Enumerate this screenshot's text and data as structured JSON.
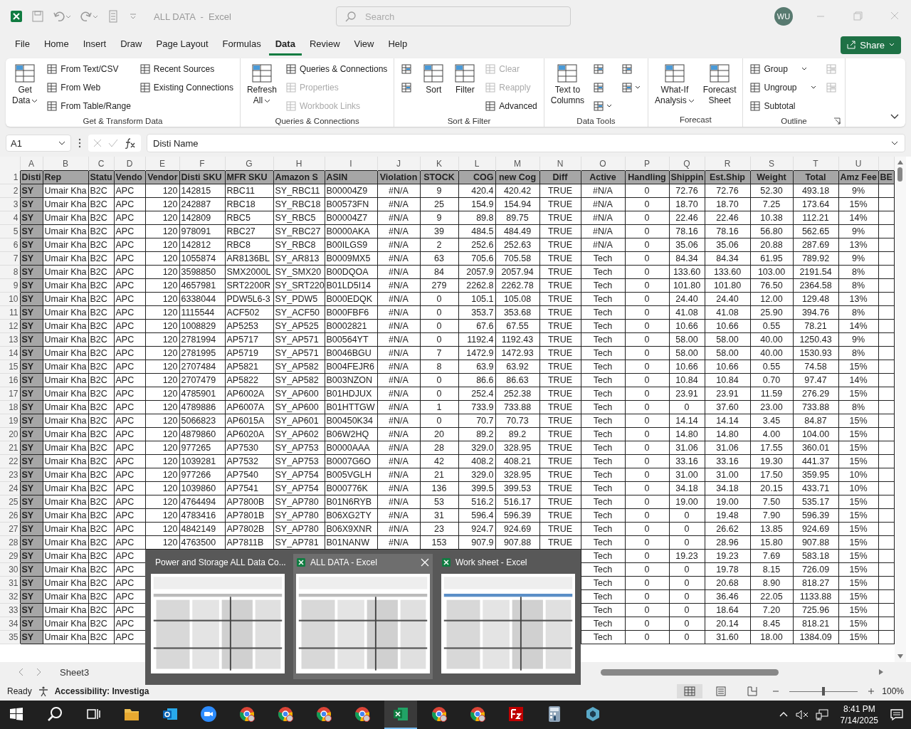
{
  "title_bar": {
    "title": "ALL DATA  -  Excel",
    "search_placeholder": "Search",
    "avatar": "WU"
  },
  "menu_tabs": [
    {
      "label": "File",
      "selected": false
    },
    {
      "label": "Home",
      "selected": false
    },
    {
      "label": "Insert",
      "selected": false
    },
    {
      "label": "Draw",
      "selected": false
    },
    {
      "label": "Page Layout",
      "selected": false
    },
    {
      "label": "Formulas",
      "selected": false
    },
    {
      "label": "Data",
      "selected": true
    },
    {
      "label": "Review",
      "selected": false
    },
    {
      "label": "View",
      "selected": false
    },
    {
      "label": "Help",
      "selected": false
    }
  ],
  "share_button": "Share",
  "ribbon_groups": [
    {
      "label": "Get & Transform Data",
      "columns": [
        [
          {
            "kind": "large",
            "lines": [
              "Get",
              "Data"
            ],
            "dropdown": true,
            "disabled": false
          }
        ],
        [
          {
            "kind": "small",
            "label": "From Text/CSV",
            "disabled": false
          },
          {
            "kind": "small",
            "label": "From Web",
            "disabled": false
          },
          {
            "kind": "small",
            "label": "From Table/Range",
            "disabled": false
          }
        ],
        [
          {
            "kind": "small",
            "label": "Recent Sources",
            "disabled": false
          },
          {
            "kind": "small",
            "label": "Existing Connections",
            "disabled": false
          }
        ]
      ]
    },
    {
      "label": "Queries & Connections",
      "columns": [
        [
          {
            "kind": "large",
            "lines": [
              "Refresh",
              "All"
            ],
            "dropdown": true,
            "disabled": false
          }
        ],
        [
          {
            "kind": "small",
            "label": "Queries & Connections",
            "disabled": false
          },
          {
            "kind": "small",
            "label": "Properties",
            "disabled": true
          },
          {
            "kind": "small",
            "label": "Workbook Links",
            "disabled": true
          }
        ]
      ]
    },
    {
      "label": "Sort & Filter",
      "columns": [
        [
          {
            "kind": "icon",
            "disabled": false
          },
          {
            "kind": "icon",
            "disabled": false
          }
        ],
        [
          {
            "kind": "large",
            "lines": [
              "Sort"
            ],
            "disabled": false
          }
        ],
        [
          {
            "kind": "large",
            "lines": [
              "Filter"
            ],
            "disabled": false
          }
        ],
        [
          {
            "kind": "small",
            "label": "Clear",
            "disabled": true
          },
          {
            "kind": "small",
            "label": "Reapply",
            "disabled": true
          },
          {
            "kind": "small",
            "label": "Advanced",
            "disabled": false
          }
        ]
      ]
    },
    {
      "label": "Data Tools",
      "columns": [
        [
          {
            "kind": "large",
            "lines": [
              "Text to",
              "Columns"
            ],
            "disabled": false
          }
        ],
        [
          {
            "kind": "icon",
            "disabled": false
          },
          {
            "kind": "icon",
            "disabled": false
          },
          {
            "kind": "icon",
            "dropdown": true,
            "disabled": false
          }
        ],
        [
          {
            "kind": "icon",
            "disabled": false
          },
          {
            "kind": "icon",
            "dropdown": true,
            "disabled": false
          }
        ]
      ]
    },
    {
      "label": "Forecast",
      "columns": [
        [
          {
            "kind": "large",
            "lines": [
              "What-If",
              "Analysis"
            ],
            "dropdown": true,
            "disabled": false
          }
        ],
        [
          {
            "kind": "large",
            "lines": [
              "Forecast",
              "Sheet"
            ],
            "disabled": false
          }
        ]
      ]
    },
    {
      "label": "Outline",
      "launcher": true,
      "columns": [
        [
          {
            "kind": "small",
            "label": "Group",
            "dropdown": true,
            "disabled": false
          },
          {
            "kind": "small",
            "label": "Ungroup",
            "dropdown": true,
            "disabled": false
          },
          {
            "kind": "small",
            "label": "Subtotal",
            "disabled": false
          }
        ],
        [
          {
            "kind": "icon",
            "disabled": true
          },
          {
            "kind": "icon",
            "disabled": true
          }
        ]
      ]
    }
  ],
  "formula_bar": {
    "name_box": "A1",
    "value": "Disti Name"
  },
  "sheet": {
    "columns": [
      "A",
      "B",
      "C",
      "D",
      "E",
      "F",
      "G",
      "H",
      "I",
      "J",
      "K",
      "L",
      "M",
      "N",
      "O",
      "P",
      "Q",
      "R",
      "S",
      "T",
      "U"
    ],
    "rows": [
      {
        "number": "1",
        "cells": [
          "Disti",
          "Rep",
          "Statu",
          "Vendo",
          "Vendor",
          "Disti SKU",
          "MFR SKU",
          "Amazon S",
          "ASIN",
          "Violation",
          "STOCK",
          "COG",
          "new Cog",
          "Diff",
          "Active",
          "Handling",
          "Shippin",
          "Est.Ship",
          "Weight",
          "Total",
          "Amz Fee",
          "BE"
        ]
      },
      {
        "number": "2",
        "cells": [
          "SY",
          "Umair Kha",
          "B2C",
          "APC",
          "120",
          "142815",
          "RBC11",
          "SY_RBC11",
          "B00004Z9",
          "#N/A",
          "9",
          "420.4",
          "420.42",
          "TRUE",
          "#N/A",
          "0",
          "72.76",
          "72.76",
          "52.30",
          "493.18",
          "9%"
        ]
      },
      {
        "number": "3",
        "cells": [
          "SY",
          "Umair Kha",
          "B2C",
          "APC",
          "120",
          "242887",
          "RBC18",
          "SY_RBC18",
          "B00573FN",
          "#N/A",
          "25",
          "154.9",
          "154.94",
          "TRUE",
          "#N/A",
          "0",
          "18.70",
          "18.70",
          "7.25",
          "173.64",
          "15%"
        ]
      },
      {
        "number": "4",
        "cells": [
          "SY",
          "Umair Kha",
          "B2C",
          "APC",
          "120",
          "142809",
          "RBC5",
          "SY_RBC5",
          "B00004Z7",
          "#N/A",
          "9",
          "89.8",
          "89.75",
          "TRUE",
          "#N/A",
          "0",
          "22.46",
          "22.46",
          "10.38",
          "112.21",
          "14%"
        ]
      },
      {
        "number": "5",
        "cells": [
          "SY",
          "Umair Kha",
          "B2C",
          "APC",
          "120",
          "978091",
          "RBC27",
          "SY_RBC27",
          "B0000AKA",
          "#N/A",
          "39",
          "484.5",
          "484.49",
          "TRUE",
          "#N/A",
          "0",
          "78.16",
          "78.16",
          "56.80",
          "562.65",
          "9%"
        ]
      },
      {
        "number": "6",
        "cells": [
          "SY",
          "Umair Kha",
          "B2C",
          "APC",
          "120",
          "142812",
          "RBC8",
          "SY_RBC8",
          "B00ILGS9",
          "#N/A",
          "2",
          "252.6",
          "252.63",
          "TRUE",
          "#N/A",
          "0",
          "35.06",
          "35.06",
          "20.88",
          "287.69",
          "13%"
        ]
      },
      {
        "number": "7",
        "cells": [
          "SY",
          "Umair Kha",
          "B2C",
          "APC",
          "120",
          "1055874",
          "AR8136BL",
          "SY_AR813",
          "B0009MX5",
          "#N/A",
          "63",
          "705.6",
          "705.58",
          "TRUE",
          "Tech",
          "0",
          "84.34",
          "84.34",
          "61.95",
          "789.92",
          "9%"
        ]
      },
      {
        "number": "8",
        "cells": [
          "SY",
          "Umair Kha",
          "B2C",
          "APC",
          "120",
          "3598850",
          "SMX2000L",
          "SY_SMX20",
          "B00DQOA",
          "#N/A",
          "84",
          "2057.9",
          "2057.94",
          "TRUE",
          "Tech",
          "0",
          "133.60",
          "133.60",
          "103.00",
          "2191.54",
          "8%"
        ]
      },
      {
        "number": "9",
        "cells": [
          "SY",
          "Umair Kha",
          "B2C",
          "APC",
          "120",
          "4657981",
          "SRT2200R",
          "SY_SRT220",
          "B01LD5I14",
          "#N/A",
          "279",
          "2262.8",
          "2262.78",
          "TRUE",
          "Tech",
          "0",
          "101.80",
          "101.80",
          "76.50",
          "2364.58",
          "8%"
        ]
      },
      {
        "number": "10",
        "cells": [
          "SY",
          "Umair Kha",
          "B2C",
          "APC",
          "120",
          "6338044",
          "PDW5L6-3",
          "SY_PDW5",
          "B000EDQK",
          "#N/A",
          "0",
          "105.1",
          "105.08",
          "TRUE",
          "Tech",
          "0",
          "24.40",
          "24.40",
          "12.00",
          "129.48",
          "13%"
        ]
      },
      {
        "number": "11",
        "cells": [
          "SY",
          "Umair Kha",
          "B2C",
          "APC",
          "120",
          "1115544",
          "ACF502",
          "SY_ACF50",
          "B000FBF6",
          "#N/A",
          "0",
          "353.7",
          "353.68",
          "TRUE",
          "Tech",
          "0",
          "41.08",
          "41.08",
          "25.90",
          "394.76",
          "8%"
        ]
      },
      {
        "number": "12",
        "cells": [
          "SY",
          "Umair Kha",
          "B2C",
          "APC",
          "120",
          "1008829",
          "AP5253",
          "SY_AP525",
          "B0002821",
          "#N/A",
          "0",
          "67.6",
          "67.55",
          "TRUE",
          "Tech",
          "0",
          "10.66",
          "10.66",
          "0.55",
          "78.21",
          "14%"
        ]
      },
      {
        "number": "13",
        "cells": [
          "SY",
          "Umair Kha",
          "B2C",
          "APC",
          "120",
          "2781994",
          "AP5717",
          "SY_AP571",
          "B00564YT",
          "#N/A",
          "0",
          "1192.4",
          "1192.43",
          "TRUE",
          "Tech",
          "0",
          "58.00",
          "58.00",
          "40.00",
          "1250.43",
          "9%"
        ]
      },
      {
        "number": "14",
        "cells": [
          "SY",
          "Umair Kha",
          "B2C",
          "APC",
          "120",
          "2781995",
          "AP5719",
          "SY_AP571",
          "B0046BGU",
          "#N/A",
          "7",
          "1472.9",
          "1472.93",
          "TRUE",
          "Tech",
          "0",
          "58.00",
          "58.00",
          "40.00",
          "1530.93",
          "8%"
        ]
      },
      {
        "number": "15",
        "cells": [
          "SY",
          "Umair Kha",
          "B2C",
          "APC",
          "120",
          "2707484",
          "AP5821",
          "SY_AP582",
          "B004FEJR6",
          "#N/A",
          "8",
          "63.9",
          "63.92",
          "TRUE",
          "Tech",
          "0",
          "10.66",
          "10.66",
          "0.55",
          "74.58",
          "15%"
        ]
      },
      {
        "number": "16",
        "cells": [
          "SY",
          "Umair Kha",
          "B2C",
          "APC",
          "120",
          "2707479",
          "AP5822",
          "SY_AP582",
          "B003NZON",
          "#N/A",
          "0",
          "86.6",
          "86.63",
          "TRUE",
          "Tech",
          "0",
          "10.84",
          "10.84",
          "0.70",
          "97.47",
          "14%"
        ]
      },
      {
        "number": "17",
        "cells": [
          "SY",
          "Umair Kha",
          "B2C",
          "APC",
          "120",
          "4785901",
          "AP6002A",
          "SY_AP600",
          "B01HDJUX",
          "#N/A",
          "0",
          "252.4",
          "252.38",
          "TRUE",
          "Tech",
          "0",
          "23.91",
          "23.91",
          "11.59",
          "276.29",
          "15%"
        ]
      },
      {
        "number": "18",
        "cells": [
          "SY",
          "Umair Kha",
          "B2C",
          "APC",
          "120",
          "4789886",
          "AP6007A",
          "SY_AP600",
          "B01HTTGW",
          "#N/A",
          "1",
          "733.9",
          "733.88",
          "TRUE",
          "Tech",
          "0",
          "0",
          "37.60",
          "23.00",
          "733.88",
          "8%"
        ]
      },
      {
        "number": "19",
        "cells": [
          "SY",
          "Umair Kha",
          "B2C",
          "APC",
          "120",
          "5066823",
          "AP6015A",
          "SY_AP601",
          "B00450K34",
          "#N/A",
          "0",
          "70.7",
          "70.73",
          "TRUE",
          "Tech",
          "0",
          "14.14",
          "14.14",
          "3.45",
          "84.87",
          "15%"
        ]
      },
      {
        "number": "20",
        "cells": [
          "SY",
          "Umair Kha",
          "B2C",
          "APC",
          "120",
          "4879860",
          "AP6020A",
          "SY_AP602",
          "B06W2HQ",
          "#N/A",
          "20",
          "89.2",
          "89.2",
          "TRUE",
          "Tech",
          "0",
          "14.80",
          "14.80",
          "4.00",
          "104.00",
          "15%"
        ]
      },
      {
        "number": "21",
        "cells": [
          "SY",
          "Umair Kha",
          "B2C",
          "APC",
          "120",
          "977265",
          "AP7530",
          "SY_AP753",
          "B0000AAA",
          "#N/A",
          "28",
          "329.0",
          "328.95",
          "TRUE",
          "Tech",
          "0",
          "31.06",
          "31.06",
          "17.55",
          "360.01",
          "15%"
        ]
      },
      {
        "number": "22",
        "cells": [
          "SY",
          "Umair Kha",
          "B2C",
          "APC",
          "120",
          "1039281",
          "AP7532",
          "SY_AP753",
          "B0007G6O",
          "#N/A",
          "42",
          "408.2",
          "408.21",
          "TRUE",
          "Tech",
          "0",
          "33.16",
          "33.16",
          "19.30",
          "441.37",
          "15%"
        ]
      },
      {
        "number": "23",
        "cells": [
          "SY",
          "Umair Kha",
          "B2C",
          "APC",
          "120",
          "977266",
          "AP7540",
          "SY_AP754",
          "B005VGLH",
          "#N/A",
          "21",
          "329.0",
          "328.95",
          "TRUE",
          "Tech",
          "0",
          "31.00",
          "31.00",
          "17.50",
          "359.95",
          "10%"
        ]
      },
      {
        "number": "24",
        "cells": [
          "SY",
          "Umair Kha",
          "B2C",
          "APC",
          "120",
          "1039860",
          "AP7541",
          "SY_AP754",
          "B000776K",
          "#N/A",
          "136",
          "399.5",
          "399.53",
          "TRUE",
          "Tech",
          "0",
          "34.18",
          "34.18",
          "20.15",
          "433.71",
          "10%"
        ]
      },
      {
        "number": "25",
        "cells": [
          "SY",
          "Umair Kha",
          "B2C",
          "APC",
          "120",
          "4764494",
          "AP7800B",
          "SY_AP780",
          "B01N6RYB",
          "#N/A",
          "53",
          "516.2",
          "516.17",
          "TRUE",
          "Tech",
          "0",
          "19.00",
          "19.00",
          "7.50",
          "535.17",
          "15%"
        ]
      },
      {
        "number": "26",
        "cells": [
          "SY",
          "Umair Kha",
          "B2C",
          "APC",
          "120",
          "4783416",
          "AP7801B",
          "SY_AP780",
          "B06XG2TY",
          "#N/A",
          "31",
          "596.4",
          "596.39",
          "TRUE",
          "Tech",
          "0",
          "0",
          "19.48",
          "7.90",
          "596.39",
          "15%"
        ]
      },
      {
        "number": "27",
        "cells": [
          "SY",
          "Umair Kha",
          "B2C",
          "APC",
          "120",
          "4842149",
          "AP7802B",
          "SY_AP780",
          "B06X9XNR",
          "#N/A",
          "23",
          "924.7",
          "924.69",
          "TRUE",
          "Tech",
          "0",
          "0",
          "26.62",
          "13.85",
          "924.69",
          "15%"
        ]
      },
      {
        "number": "28",
        "cells": [
          "SY",
          "Umair Kha",
          "B2C",
          "APC",
          "120",
          "4763500",
          "AP7811B",
          "SY_AP781",
          "B01NANW",
          "#N/A",
          "153",
          "907.9",
          "907.88",
          "TRUE",
          "Tech",
          "0",
          "0",
          "28.96",
          "15.80",
          "907.88",
          "15%"
        ]
      },
      {
        "number": "29",
        "cells": [
          "SY",
          "Umair Kha",
          "B2C",
          "APC",
          null,
          null,
          null,
          null,
          null,
          null,
          null,
          null,
          null,
          null,
          "Tech",
          "0",
          "19.23",
          "19.23",
          "7.69",
          "583.18",
          "15%"
        ]
      },
      {
        "number": "30",
        "cells": [
          "SY",
          "Umair Kha",
          "B2C",
          "APC",
          null,
          null,
          null,
          null,
          null,
          null,
          null,
          null,
          null,
          null,
          "Tech",
          "0",
          "0",
          "19.78",
          "8.15",
          "726.09",
          "15%"
        ]
      },
      {
        "number": "31",
        "cells": [
          "SY",
          "Umair Kha",
          "B2C",
          "APC",
          null,
          null,
          null,
          null,
          null,
          null,
          null,
          null,
          null,
          null,
          "Tech",
          "0",
          "0",
          "20.68",
          "8.90",
          "818.27",
          "15%"
        ]
      },
      {
        "number": "32",
        "cells": [
          "SY",
          "Umair Kha",
          "B2C",
          "APC",
          null,
          null,
          null,
          null,
          null,
          null,
          null,
          null,
          null,
          null,
          "Tech",
          "0",
          "0",
          "36.46",
          "22.05",
          "1133.88",
          "15%"
        ]
      },
      {
        "number": "33",
        "cells": [
          "SY",
          "Umair Kha",
          "B2C",
          "APC",
          null,
          null,
          null,
          null,
          null,
          null,
          null,
          null,
          null,
          null,
          "Tech",
          "0",
          "0",
          "18.64",
          "7.20",
          "725.96",
          "15%"
        ]
      },
      {
        "number": "34",
        "cells": [
          "SY",
          "Umair Kha",
          "B2C",
          "APC",
          null,
          null,
          null,
          null,
          null,
          null,
          null,
          null,
          null,
          null,
          "Tech",
          "0",
          "0",
          "20.14",
          "8.45",
          "818.21",
          "15%"
        ]
      },
      {
        "number": "35",
        "cells": [
          "SY",
          "Umair Kha",
          "B2C",
          "APC",
          null,
          null,
          null,
          null,
          null,
          null,
          null,
          null,
          null,
          null,
          "Tech",
          "0",
          "0",
          "31.60",
          "18.00",
          "1384.09",
          "15%"
        ]
      }
    ]
  },
  "sheet_tabs": [
    {
      "label": "Sheet3",
      "selected": false
    }
  ],
  "window_previews": [
    {
      "title": "Power and Storage ALL Data Co...",
      "selected": false
    },
    {
      "title": "ALL DATA - Excel",
      "selected": true
    },
    {
      "title": "Work sheet - Excel",
      "selected": false
    }
  ],
  "status_bar": {
    "status": "Ready",
    "accessibility": "Accessibility: Investiga",
    "views": [
      {
        "kind": "normal",
        "selected": true
      },
      {
        "kind": "page-layout",
        "selected": false
      },
      {
        "kind": "page-break",
        "selected": false
      }
    ],
    "zoom": {
      "level": 0.5,
      "reading": "100%"
    }
  },
  "taskbar": {
    "items": [
      {
        "kind": "start",
        "active": false
      },
      {
        "kind": "search",
        "active": false
      },
      {
        "kind": "task-view",
        "active": false
      },
      {
        "kind": "folder",
        "active": false
      },
      {
        "kind": "mail",
        "active": false
      },
      {
        "kind": "video",
        "active": false
      },
      {
        "kind": "browser",
        "active": false
      },
      {
        "kind": "browser",
        "active": false
      },
      {
        "kind": "browser",
        "active": false
      },
      {
        "kind": "browser",
        "active": false
      },
      {
        "kind": "spreadsheet",
        "active": true
      },
      {
        "kind": "browser",
        "active": false
      },
      {
        "kind": "browser",
        "active": false
      },
      {
        "kind": "ftp",
        "active": false
      },
      {
        "kind": "calculator",
        "active": false
      },
      {
        "kind": "app",
        "active": false
      }
    ],
    "time": "8:41 PM",
    "date": "7/14/2025"
  }
}
